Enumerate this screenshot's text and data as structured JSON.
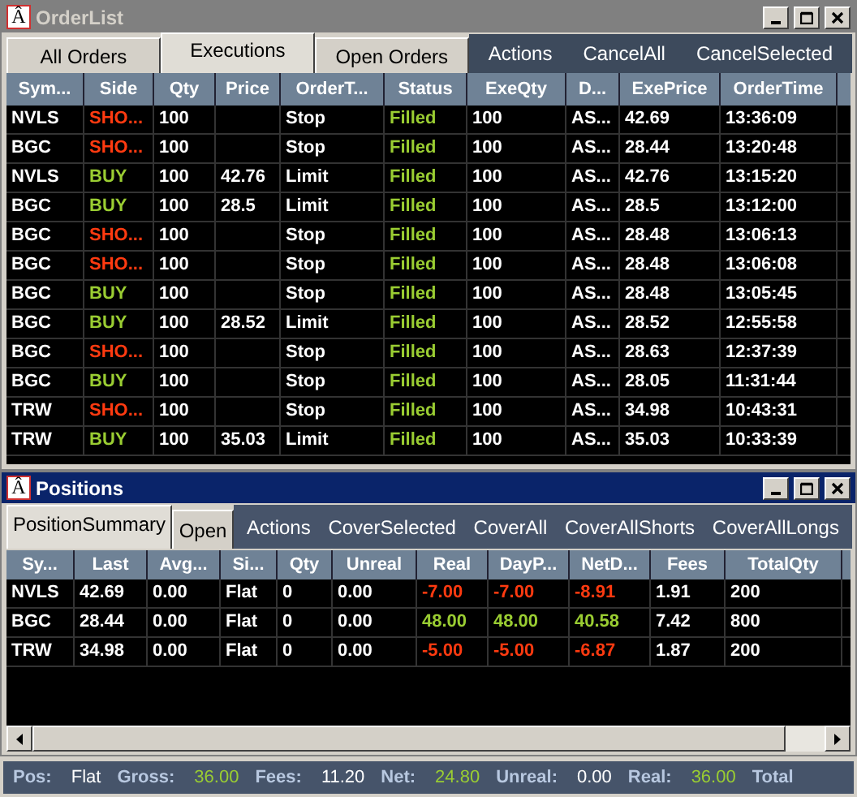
{
  "order_window": {
    "icon_letter": "Â",
    "title": "OrderList",
    "active": false,
    "tabs": [
      {
        "label": "All Orders",
        "selected": false
      },
      {
        "label": "Executions",
        "selected": true
      },
      {
        "label": "Open Orders",
        "selected": false
      }
    ],
    "actions": [
      "Actions",
      "CancelAll",
      "CancelSelected"
    ],
    "columns": [
      "Sym...",
      "Side",
      "Qty",
      "Price",
      "OrderT...",
      "Status",
      "ExeQty",
      "D...",
      "ExePrice",
      "OrderTime"
    ],
    "rows": [
      {
        "symbol": "NVLS",
        "side": "SHO...",
        "short": true,
        "qty": "100",
        "price": "",
        "order_type": "Stop",
        "status": "Filled",
        "exe_qty": "100",
        "d": "AS...",
        "exe_price": "42.69",
        "order_time": "13:36:09"
      },
      {
        "symbol": "BGC",
        "side": "SHO...",
        "short": true,
        "qty": "100",
        "price": "",
        "order_type": "Stop",
        "status": "Filled",
        "exe_qty": "100",
        "d": "AS...",
        "exe_price": "28.44",
        "order_time": "13:20:48"
      },
      {
        "symbol": "NVLS",
        "side": "BUY",
        "short": false,
        "qty": "100",
        "price": "42.76",
        "order_type": "Limit",
        "status": "Filled",
        "exe_qty": "100",
        "d": "AS...",
        "exe_price": "42.76",
        "order_time": "13:15:20"
      },
      {
        "symbol": "BGC",
        "side": "BUY",
        "short": false,
        "qty": "100",
        "price": "28.5",
        "order_type": "Limit",
        "status": "Filled",
        "exe_qty": "100",
        "d": "AS...",
        "exe_price": "28.5",
        "order_time": "13:12:00"
      },
      {
        "symbol": "BGC",
        "side": "SHO...",
        "short": true,
        "qty": "100",
        "price": "",
        "order_type": "Stop",
        "status": "Filled",
        "exe_qty": "100",
        "d": "AS...",
        "exe_price": "28.48",
        "order_time": "13:06:13"
      },
      {
        "symbol": "BGC",
        "side": "SHO...",
        "short": true,
        "qty": "100",
        "price": "",
        "order_type": "Stop",
        "status": "Filled",
        "exe_qty": "100",
        "d": "AS...",
        "exe_price": "28.48",
        "order_time": "13:06:08"
      },
      {
        "symbol": "BGC",
        "side": "BUY",
        "short": false,
        "qty": "100",
        "price": "",
        "order_type": "Stop",
        "status": "Filled",
        "exe_qty": "100",
        "d": "AS...",
        "exe_price": "28.48",
        "order_time": "13:05:45"
      },
      {
        "symbol": "BGC",
        "side": "BUY",
        "short": false,
        "qty": "100",
        "price": "28.52",
        "order_type": "Limit",
        "status": "Filled",
        "exe_qty": "100",
        "d": "AS...",
        "exe_price": "28.52",
        "order_time": "12:55:58"
      },
      {
        "symbol": "BGC",
        "side": "SHO...",
        "short": true,
        "qty": "100",
        "price": "",
        "order_type": "Stop",
        "status": "Filled",
        "exe_qty": "100",
        "d": "AS...",
        "exe_price": "28.63",
        "order_time": "12:37:39"
      },
      {
        "symbol": "BGC",
        "side": "BUY",
        "short": false,
        "qty": "100",
        "price": "",
        "order_type": "Stop",
        "status": "Filled",
        "exe_qty": "100",
        "d": "AS...",
        "exe_price": "28.05",
        "order_time": "11:31:44"
      },
      {
        "symbol": "TRW",
        "side": "SHO...",
        "short": true,
        "qty": "100",
        "price": "",
        "order_type": "Stop",
        "status": "Filled",
        "exe_qty": "100",
        "d": "AS...",
        "exe_price": "34.98",
        "order_time": "10:43:31"
      },
      {
        "symbol": "TRW",
        "side": "BUY",
        "short": false,
        "qty": "100",
        "price": "35.03",
        "order_type": "Limit",
        "status": "Filled",
        "exe_qty": "100",
        "d": "AS...",
        "exe_price": "35.03",
        "order_time": "10:33:39"
      }
    ]
  },
  "positions_window": {
    "icon_letter": "Â",
    "title": "Positions",
    "active": true,
    "tabs": [
      {
        "label": "PositionSummary",
        "selected": true
      },
      {
        "label": "Open",
        "selected": false
      }
    ],
    "actions": [
      "Actions",
      "CoverSelected",
      "CoverAll",
      "CoverAllShorts",
      "CoverAllLongs"
    ],
    "columns": [
      "Sy...",
      "Last",
      "Avg...",
      "Si...",
      "Qty",
      "Unreal",
      "Real",
      "DayP...",
      "NetD...",
      "Fees",
      "TotalQty"
    ],
    "rows": [
      {
        "symbol": "NVLS",
        "last": "42.69",
        "avg": "0.00",
        "side": "Flat",
        "qty": "0",
        "unreal": "0.00",
        "real": "-7.00",
        "day_pnl": "-7.00",
        "net": "-8.91",
        "fees": "1.91",
        "total_qty": "200",
        "loss": true
      },
      {
        "symbol": "BGC",
        "last": "28.44",
        "avg": "0.00",
        "side": "Flat",
        "qty": "0",
        "unreal": "0.00",
        "real": "48.00",
        "day_pnl": "48.00",
        "net": "40.58",
        "fees": "7.42",
        "total_qty": "800",
        "loss": false
      },
      {
        "symbol": "TRW",
        "last": "34.98",
        "avg": "0.00",
        "side": "Flat",
        "qty": "0",
        "unreal": "0.00",
        "real": "-5.00",
        "day_pnl": "-5.00",
        "net": "-6.87",
        "fees": "1.87",
        "total_qty": "200",
        "loss": true
      }
    ]
  },
  "status_bar": [
    {
      "label": "Pos:",
      "value": "Flat",
      "gain": false
    },
    {
      "label": "Gross:",
      "value": "36.00",
      "gain": true
    },
    {
      "label": "Fees:",
      "value": "11.20",
      "gain": false
    },
    {
      "label": "Net:",
      "value": "24.80",
      "gain": true
    },
    {
      "label": "Unreal:",
      "value": "0.00",
      "gain": false
    },
    {
      "label": "Real:",
      "value": "36.00",
      "gain": true
    },
    {
      "label": "Total"
    }
  ]
}
